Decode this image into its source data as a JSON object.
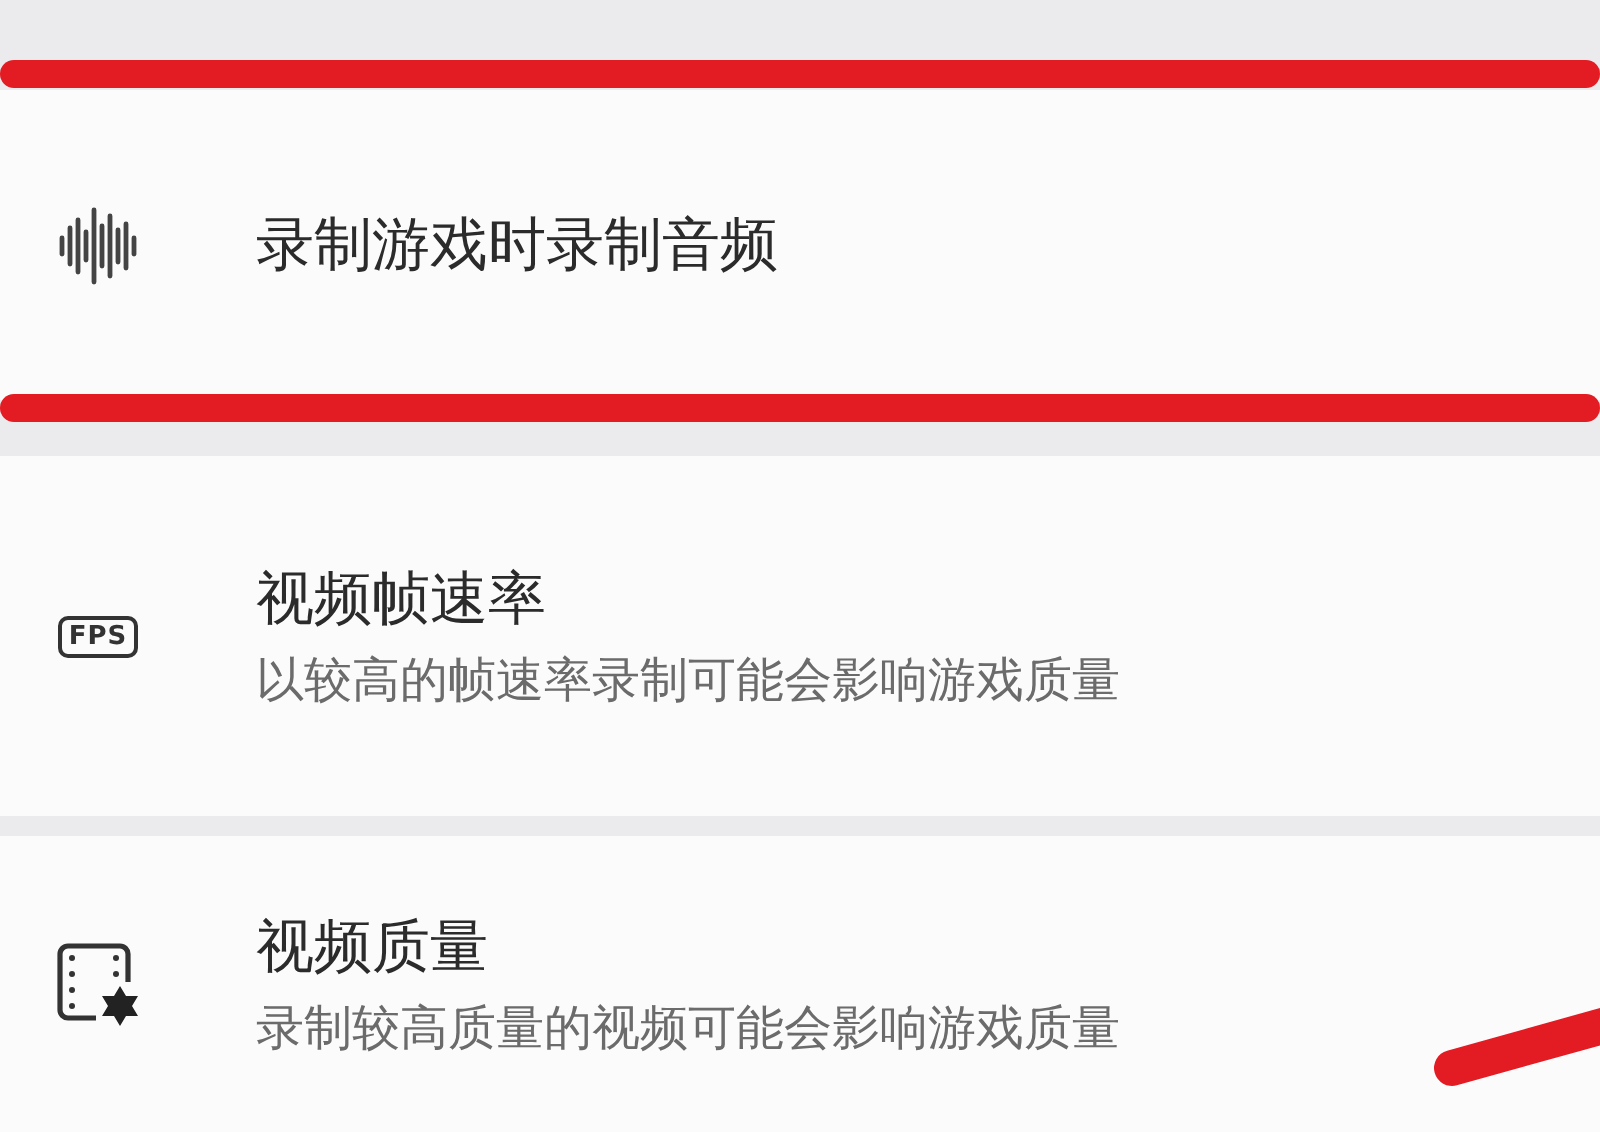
{
  "settings": [
    {
      "kind": "audio",
      "title": "录制游戏时录制音频"
    },
    {
      "kind": "fps",
      "icon_text": "FPS",
      "title": "视频帧速率",
      "description": "以较高的帧速率录制可能会影响游戏质量"
    },
    {
      "kind": "quality",
      "title": "视频质量",
      "description": "录制较高质量的视频可能会影响游戏质量"
    }
  ]
}
